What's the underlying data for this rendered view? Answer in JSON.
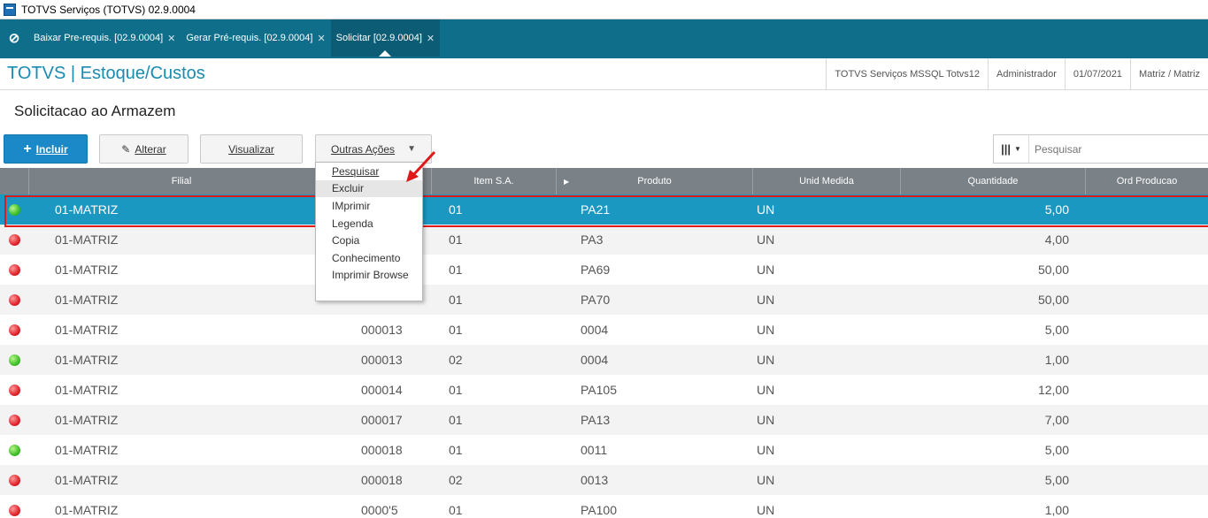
{
  "window": {
    "title": "TOTVS Serviços (TOTVS) 02.9.0004"
  },
  "tabs": [
    {
      "label": "Baixar Pre-requis. [02.9.0004]",
      "active": false
    },
    {
      "label": "Gerar Pré-requis. [02.9.0004]",
      "active": false
    },
    {
      "label": "Solicitar [02.9.0004]",
      "active": true
    }
  ],
  "header": {
    "module": "TOTVS | Estoque/Custos",
    "server": "TOTVS Serviços MSSQL Totvs12",
    "user": "Administrador",
    "date": "01/07/2021",
    "branch": "Matriz / Matriz"
  },
  "page": {
    "title": "Solicitacao ao Armazem"
  },
  "toolbar": {
    "incluir": "Incluir",
    "alterar": "Alterar",
    "visualizar": "Visualizar",
    "outras_acoes": "Outras Ações",
    "search_placeholder": "Pesquisar"
  },
  "menu": {
    "items": [
      "Pesquisar",
      "Excluir",
      "IMprimir",
      "Legenda",
      "Copia",
      "Conhecimento",
      "Imprimir Browse"
    ]
  },
  "grid": {
    "columns": [
      "",
      "Filial",
      "",
      "Item S.A.",
      "Produto",
      "Unid Medida",
      "Quantidade",
      "Ord Producao"
    ],
    "rows": [
      {
        "status": "green",
        "filial": "01-MATRIZ",
        "numero": "",
        "item": "01",
        "produto": "PA21",
        "unid": "UN",
        "qtd": "5,00",
        "selected": true
      },
      {
        "status": "red",
        "filial": "01-MATRIZ",
        "numero": "",
        "item": "01",
        "produto": "PA3",
        "unid": "UN",
        "qtd": "4,00"
      },
      {
        "status": "red",
        "filial": "01-MATRIZ",
        "numero": "",
        "item": "01",
        "produto": "PA69",
        "unid": "UN",
        "qtd": "50,00"
      },
      {
        "status": "red",
        "filial": "01-MATRIZ",
        "numero": "",
        "item": "01",
        "produto": "PA70",
        "unid": "UN",
        "qtd": "50,00"
      },
      {
        "status": "red",
        "filial": "01-MATRIZ",
        "numero": "000013",
        "item": "01",
        "produto": "0004",
        "unid": "UN",
        "qtd": "5,00"
      },
      {
        "status": "green",
        "filial": "01-MATRIZ",
        "numero": "000013",
        "item": "02",
        "produto": "0004",
        "unid": "UN",
        "qtd": "1,00"
      },
      {
        "status": "red",
        "filial": "01-MATRIZ",
        "numero": "000014",
        "item": "01",
        "produto": "PA105",
        "unid": "UN",
        "qtd": "12,00"
      },
      {
        "status": "red",
        "filial": "01-MATRIZ",
        "numero": "000017",
        "item": "01",
        "produto": "PA13",
        "unid": "UN",
        "qtd": "7,00"
      },
      {
        "status": "green",
        "filial": "01-MATRIZ",
        "numero": "000018",
        "item": "01",
        "produto": "0011",
        "unid": "UN",
        "qtd": "5,00"
      },
      {
        "status": "red",
        "filial": "01-MATRIZ",
        "numero": "000018",
        "item": "02",
        "produto": "0013",
        "unid": "UN",
        "qtd": "5,00"
      },
      {
        "status": "red",
        "filial": "01-MATRIZ",
        "numero": "0000'5",
        "item": "01",
        "produto": "PA100",
        "unid": "UN",
        "qtd": "1,00"
      }
    ]
  },
  "colors": {
    "tabbar": "#0f6f8b",
    "accent": "#1a8bb0",
    "selected_row": "#1b98c2",
    "highlight_outline": "#e01919",
    "primary_button": "#1b88c8"
  }
}
